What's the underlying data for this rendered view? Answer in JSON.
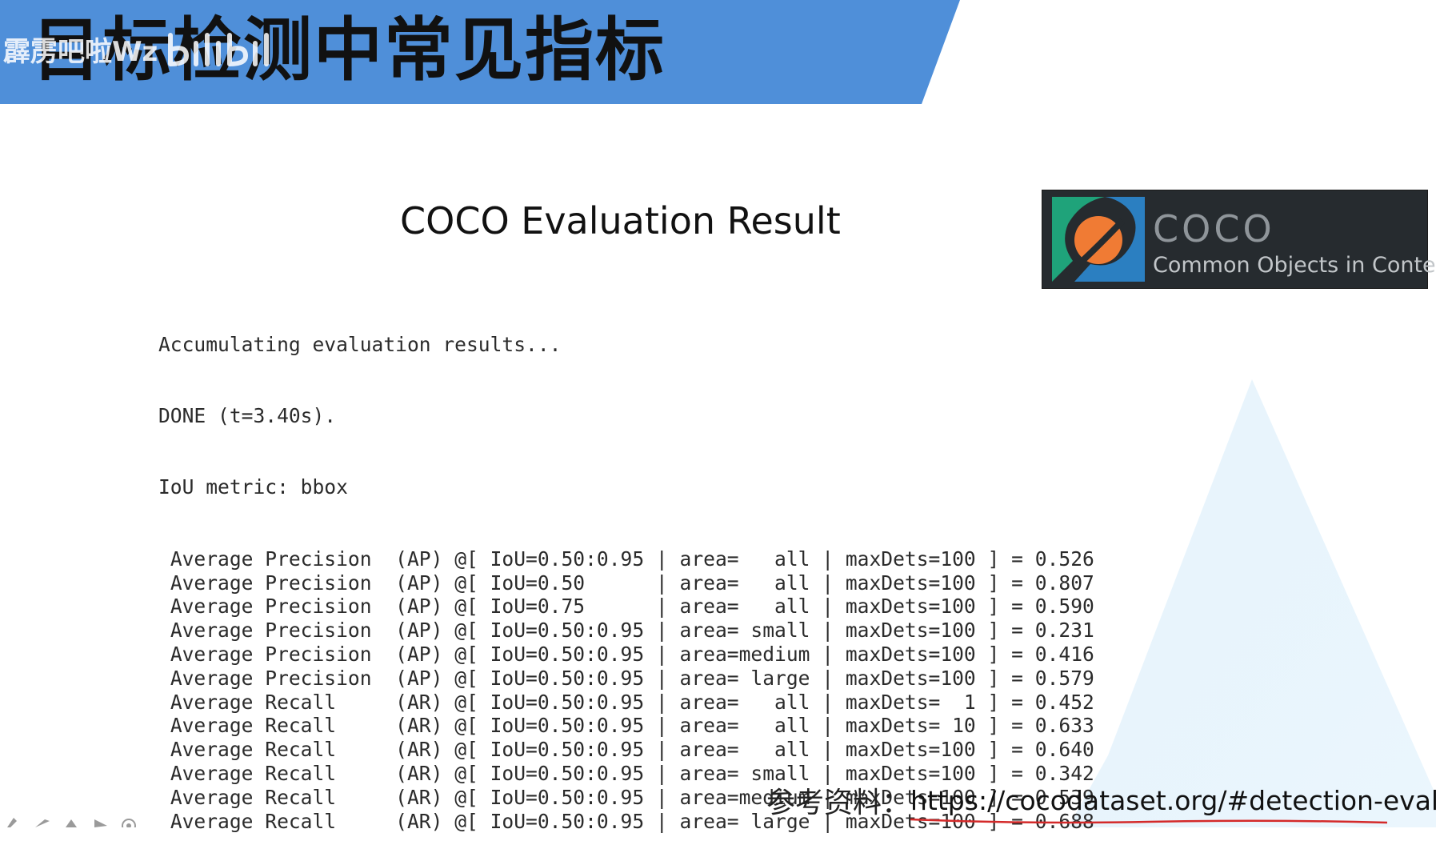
{
  "header": {
    "title": "目标检测中常见指标",
    "watermark_text": "霹雳吧啦Wz",
    "banner_color": "#4f8fd9"
  },
  "slide": {
    "heading": "COCO Evaluation Result"
  },
  "coco_logo": {
    "name": "COCO",
    "tagline": "Common Objects in Context",
    "mark_icon": "coco-swirl-icon",
    "colors": {
      "background": "#262b2f",
      "green": "#1fa37a",
      "blue": "#2b7fc1",
      "orange": "#f07b34"
    }
  },
  "terminal": {
    "intro_lines": [
      "Accumulating evaluation results...",
      "DONE (t=3.40s).",
      "IoU metric: bbox"
    ],
    "metrics": [
      {
        "metric": "Average Precision",
        "abbr": "(AP)",
        "iou": "0.50:0.95",
        "area": "   all",
        "max_dets": "100",
        "value": "0.526"
      },
      {
        "metric": "Average Precision",
        "abbr": "(AP)",
        "iou": "0.50     ",
        "area": "   all",
        "max_dets": "100",
        "value": "0.807"
      },
      {
        "metric": "Average Precision",
        "abbr": "(AP)",
        "iou": "0.75     ",
        "area": "   all",
        "max_dets": "100",
        "value": "0.590"
      },
      {
        "metric": "Average Precision",
        "abbr": "(AP)",
        "iou": "0.50:0.95",
        "area": " small",
        "max_dets": "100",
        "value": "0.231"
      },
      {
        "metric": "Average Precision",
        "abbr": "(AP)",
        "iou": "0.50:0.95",
        "area": "medium",
        "max_dets": "100",
        "value": "0.416"
      },
      {
        "metric": "Average Precision",
        "abbr": "(AP)",
        "iou": "0.50:0.95",
        "area": " large",
        "max_dets": "100",
        "value": "0.579"
      },
      {
        "metric": "Average Recall   ",
        "abbr": "(AR)",
        "iou": "0.50:0.95",
        "area": "   all",
        "max_dets": "  1",
        "value": "0.452"
      },
      {
        "metric": "Average Recall   ",
        "abbr": "(AR)",
        "iou": "0.50:0.95",
        "area": "   all",
        "max_dets": " 10",
        "value": "0.633"
      },
      {
        "metric": "Average Recall   ",
        "abbr": "(AR)",
        "iou": "0.50:0.95",
        "area": "   all",
        "max_dets": "100",
        "value": "0.640"
      },
      {
        "metric": "Average Recall   ",
        "abbr": "(AR)",
        "iou": "0.50:0.95",
        "area": " small",
        "max_dets": "100",
        "value": "0.342"
      },
      {
        "metric": "Average Recall   ",
        "abbr": "(AR)",
        "iou": "0.50:0.95",
        "area": "medium",
        "max_dets": "100",
        "value": "0.539"
      },
      {
        "metric": "Average Recall   ",
        "abbr": "(AR)",
        "iou": "0.50:0.95",
        "area": " large",
        "max_dets": "100",
        "value": "0.688"
      }
    ]
  },
  "reference": {
    "label": "参考资料：",
    "url": "https://cocodataset.org/#detection-eval",
    "underline_color": "#d42a2a"
  },
  "toolbar": {
    "icons": [
      "pen-icon",
      "arrow-icon",
      "eraser-icon",
      "play-icon",
      "settings-icon"
    ]
  }
}
